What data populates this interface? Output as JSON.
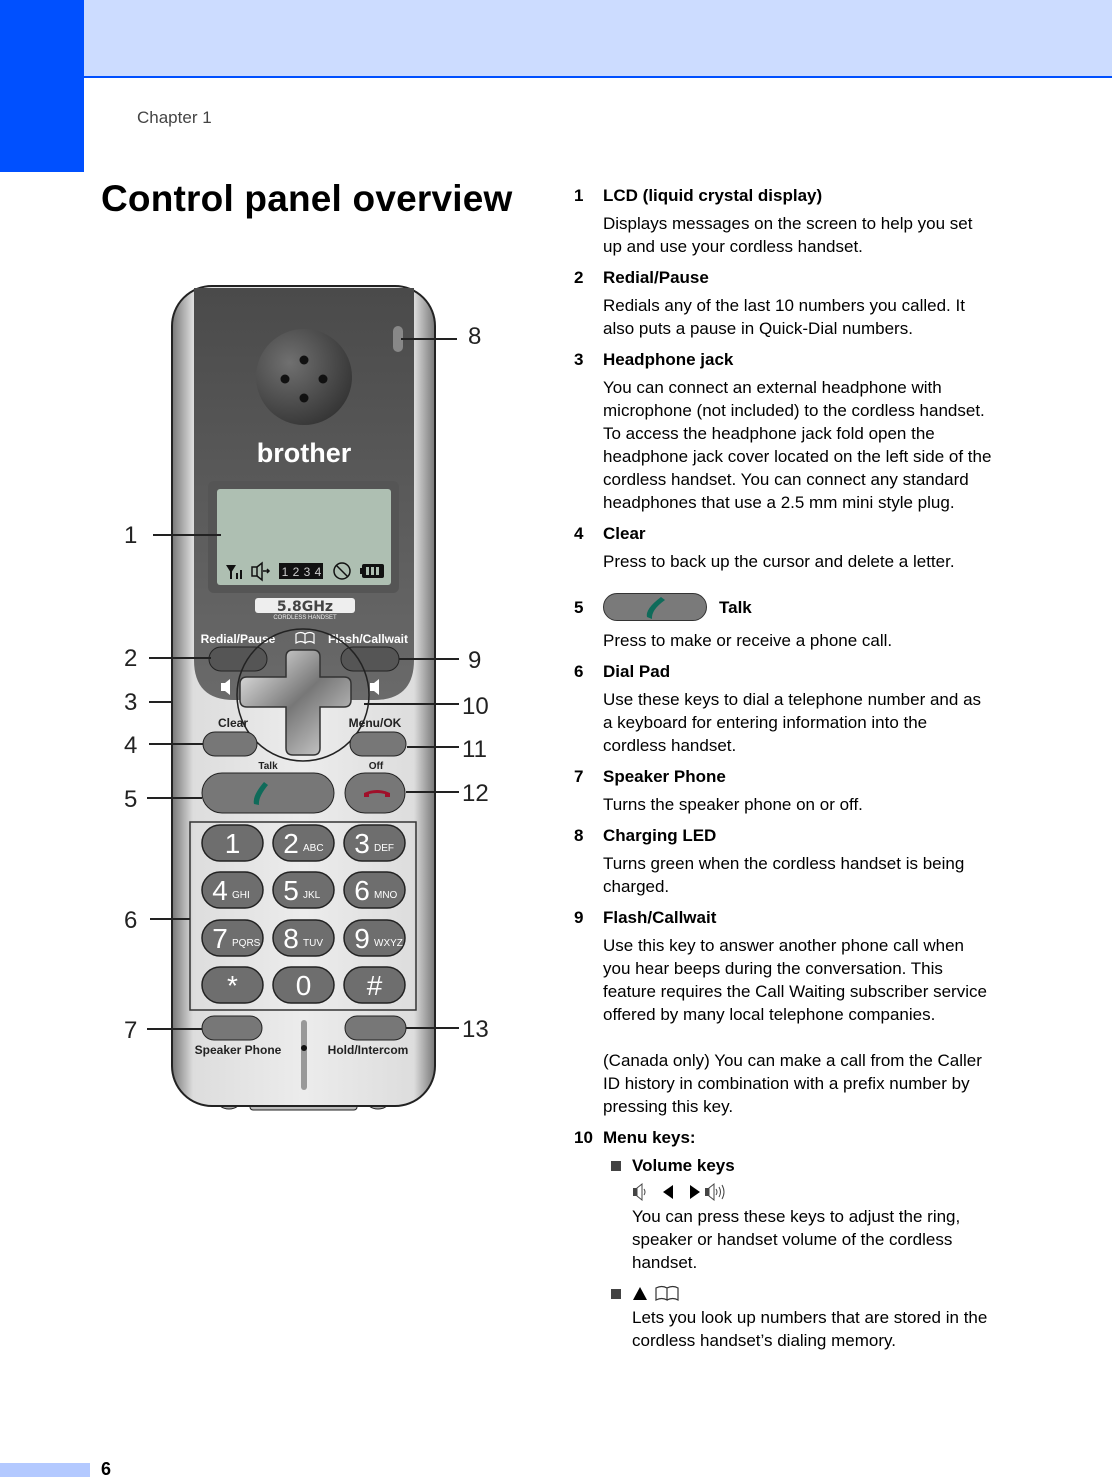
{
  "header": {
    "chapter": "Chapter 1",
    "title": "Control panel overview",
    "accent_color": "#0050ff",
    "band_color": "#ccdcff"
  },
  "footer": {
    "page_number": "6"
  },
  "phone": {
    "brand": "brother",
    "badge_main": "5.8GHz",
    "badge_sub": "CORDLESS HANDSET",
    "lcd_channels": [
      "1",
      "2",
      "3",
      "4"
    ],
    "labels": {
      "redial": "Redial/Pause",
      "flash": "Flash/Callwait",
      "clear": "Clear",
      "menu": "Menu/OK",
      "talk": "Talk",
      "off": "Off",
      "speaker": "Speaker Phone",
      "hold": "Hold/Intercom"
    },
    "keys": [
      {
        "digit": "1",
        "letters": ""
      },
      {
        "digit": "2",
        "letters": "ABC"
      },
      {
        "digit": "3",
        "letters": "DEF"
      },
      {
        "digit": "4",
        "letters": "GHI"
      },
      {
        "digit": "5",
        "letters": "JKL"
      },
      {
        "digit": "6",
        "letters": "MNO"
      },
      {
        "digit": "7",
        "letters": "PQRS"
      },
      {
        "digit": "8",
        "letters": "TUV"
      },
      {
        "digit": "9",
        "letters": "WXYZ"
      },
      {
        "digit": "*",
        "letters": ""
      },
      {
        "digit": "0",
        "letters": ""
      },
      {
        "digit": "#",
        "letters": ""
      }
    ],
    "callouts": [
      "1",
      "2",
      "3",
      "4",
      "5",
      "6",
      "7",
      "8",
      "9",
      "10",
      "11",
      "12",
      "13"
    ]
  },
  "items": [
    {
      "num": "1",
      "head": "LCD (liquid crystal display)",
      "body": "Displays messages on the screen to help you set up and use your cordless handset."
    },
    {
      "num": "2",
      "head": "Redial/Pause",
      "body": "Redials any of the last 10 numbers you called. It also puts a pause in Quick-Dial numbers."
    },
    {
      "num": "3",
      "head": "Headphone jack",
      "body": "You can connect an external headphone with microphone (not included) to the cordless handset. To access the headphone jack fold open the headphone jack cover located on the left side of the cordless handset. You can connect any standard headphones that use a 2.5 mm mini style plug."
    },
    {
      "num": "4",
      "head": "Clear",
      "body": "Press to back up the cursor and delete a letter."
    },
    {
      "num": "5",
      "head": "Talk",
      "body": "Press to make or receive a phone call."
    },
    {
      "num": "6",
      "head": "Dial Pad",
      "body": "Use these keys to dial a telephone number and as a keyboard for entering information into the cordless handset."
    },
    {
      "num": "7",
      "head": "Speaker Phone",
      "body": "Turns the speaker phone on or off."
    },
    {
      "num": "8",
      "head": "Charging LED",
      "body": "Turns green when the cordless handset is being charged."
    },
    {
      "num": "9",
      "head": "Flash/Callwait",
      "body": "Use this key to answer another phone call when you hear beeps during the conversation. This feature requires the Call Waiting subscriber service offered by many local telephone companies.",
      "body2": "(Canada only) You can make a call from the Caller ID history in combination with a prefix number by pressing this key."
    },
    {
      "num": "10",
      "head": "Menu keys:"
    }
  ],
  "menu_keys": [
    {
      "head": "Volume keys",
      "icons": "volume-keys",
      "body": "You can press these keys to adjust the ring, speaker or handset volume of the cordless handset."
    },
    {
      "icons": "up-phonebook",
      "body": "Lets you look up numbers that are stored in the cordless handset’s dialing memory."
    }
  ]
}
